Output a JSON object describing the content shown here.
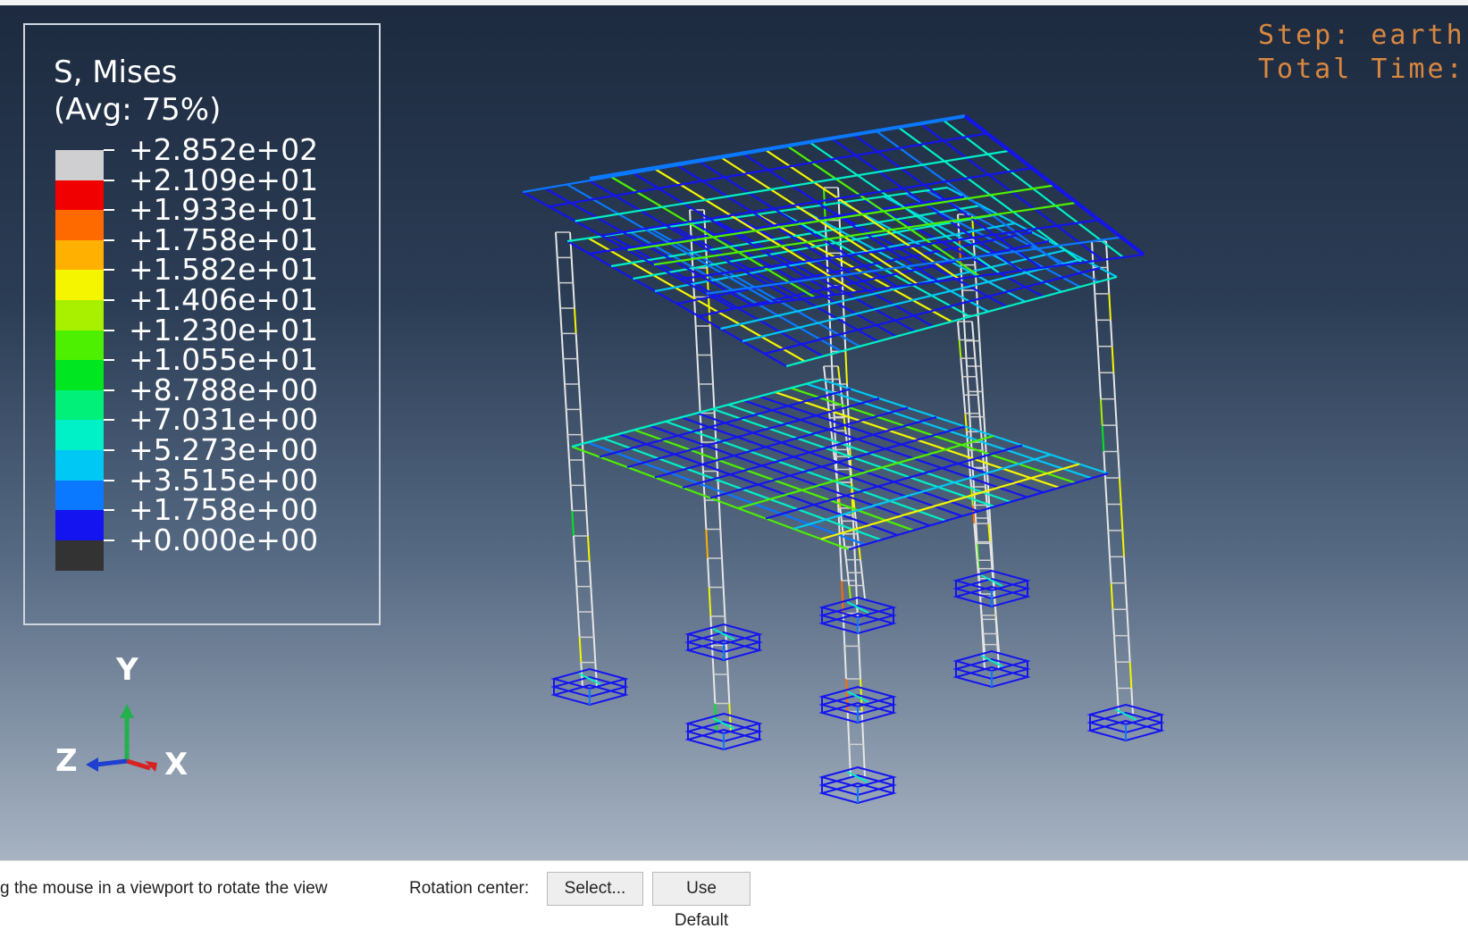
{
  "legend": {
    "title_line1": "S, Mises",
    "title_line2": "(Avg: 75%)",
    "values": [
      "+2.852e+02",
      "+2.109e+01",
      "+1.933e+01",
      "+1.758e+01",
      "+1.582e+01",
      "+1.406e+01",
      "+1.230e+01",
      "+1.055e+01",
      "+8.788e+00",
      "+7.031e+00",
      "+5.273e+00",
      "+3.515e+00",
      "+1.758e+00",
      "+0.000e+00"
    ],
    "colors": [
      "#cfcfd1",
      "#f00000",
      "#ff6a00",
      "#ffb000",
      "#f5f500",
      "#a8f000",
      "#4cf000",
      "#00e620",
      "#00f07a",
      "#00f0c8",
      "#00c8f5",
      "#0a78ff",
      "#1414f0",
      "#333333"
    ]
  },
  "step_info": {
    "step": "Step: earth",
    "total_time": "Total Time:"
  },
  "triad": {
    "y": "Y",
    "z": "Z",
    "x": "X"
  },
  "status": {
    "hint": "g the mouse in a viewport to rotate the view",
    "rotation_label": "Rotation center:",
    "select_label": "Select...",
    "default_label": "Use Default"
  }
}
